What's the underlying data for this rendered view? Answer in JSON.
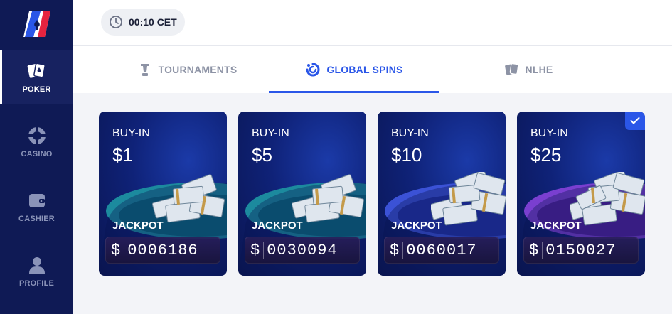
{
  "sidebar": {
    "items": [
      {
        "label": "POKER",
        "icon": "cards-icon",
        "active": true
      },
      {
        "label": "CASINO",
        "icon": "chip-icon",
        "active": false
      },
      {
        "label": "CASHIER",
        "icon": "wallet-icon",
        "active": false
      },
      {
        "label": "PROFILE",
        "icon": "user-icon",
        "active": false
      }
    ]
  },
  "header": {
    "time": "00:10 CET"
  },
  "tabs": [
    {
      "label": "TOURNAMENTS",
      "icon": "trophy-icon",
      "active": false
    },
    {
      "label": "GLOBAL SPINS",
      "icon": "spin-icon",
      "active": true
    },
    {
      "label": "NLHE",
      "icon": "cards-icon",
      "active": false
    }
  ],
  "cards": [
    {
      "buyin_label": "BUY-IN",
      "buyin_value": "$1",
      "jackpot_label": "JACKPOT",
      "currency": "$",
      "jackpot_value": "0006186",
      "selected": false
    },
    {
      "buyin_label": "BUY-IN",
      "buyin_value": "$5",
      "jackpot_label": "JACKPOT",
      "currency": "$",
      "jackpot_value": "0030094",
      "selected": false
    },
    {
      "buyin_label": "BUY-IN",
      "buyin_value": "$10",
      "jackpot_label": "JACKPOT",
      "currency": "$",
      "jackpot_value": "0060017",
      "selected": false
    },
    {
      "buyin_label": "BUY-IN",
      "buyin_value": "$25",
      "jackpot_label": "JACKPOT",
      "currency": "$",
      "jackpot_value": "0150027",
      "selected": true
    }
  ],
  "colors": {
    "sidebar_bg": "#0f1a55",
    "accent": "#2a56e8",
    "tab_inactive": "#8d93a5"
  }
}
